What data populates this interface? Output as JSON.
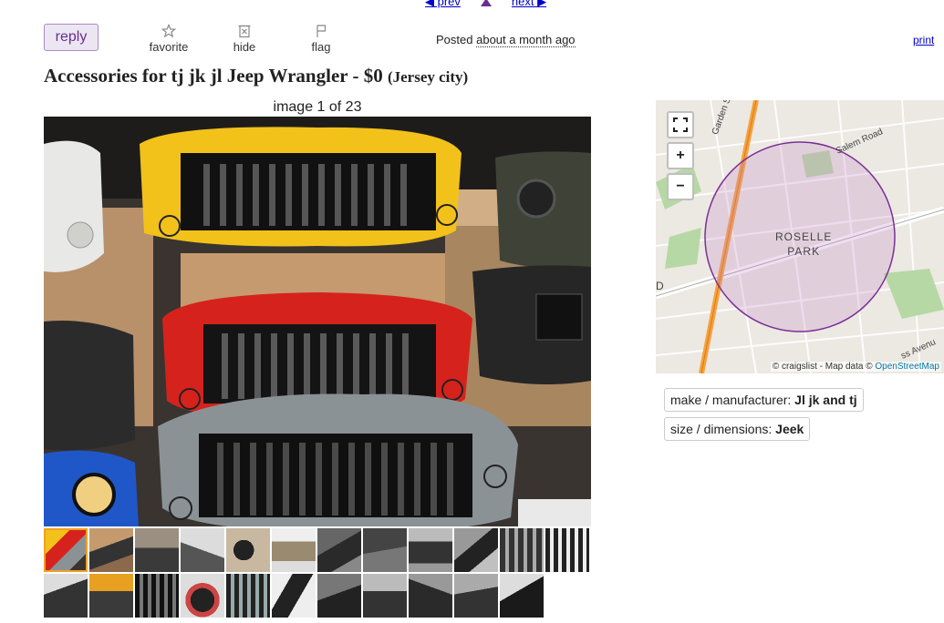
{
  "nav": {
    "prev_label": "◀ prev",
    "next_label": "next ▶"
  },
  "actions": {
    "reply_label": "reply",
    "favorite_label": "favorite",
    "hide_label": "hide",
    "flag_label": "flag",
    "print_label": "print"
  },
  "posted": {
    "prefix": "Posted",
    "relative": "about a month ago"
  },
  "listing": {
    "title": "Accessories for tj jk jl Jeep Wrangler",
    "separator": " - ",
    "price": "$0",
    "location": "(Jersey city)"
  },
  "gallery": {
    "counter": "image 1 of 23",
    "selected_index": 0
  },
  "map": {
    "area_label_line1": "ROSELLE",
    "area_label_line2": "PARK",
    "road1": "Garden State Pa",
    "road2": "Salem Road",
    "road3": "ss Avenu",
    "edge_letter": "D",
    "attribution_prefix": "© craigslist - Map data ©",
    "attribution_link": "OpenStreetMap",
    "zoom_in": "+",
    "zoom_out": "−"
  },
  "attributes": [
    {
      "key": "make / manufacturer:",
      "value": "Jl jk and tj"
    },
    {
      "key": "size / dimensions:",
      "value": "Jeek"
    }
  ]
}
